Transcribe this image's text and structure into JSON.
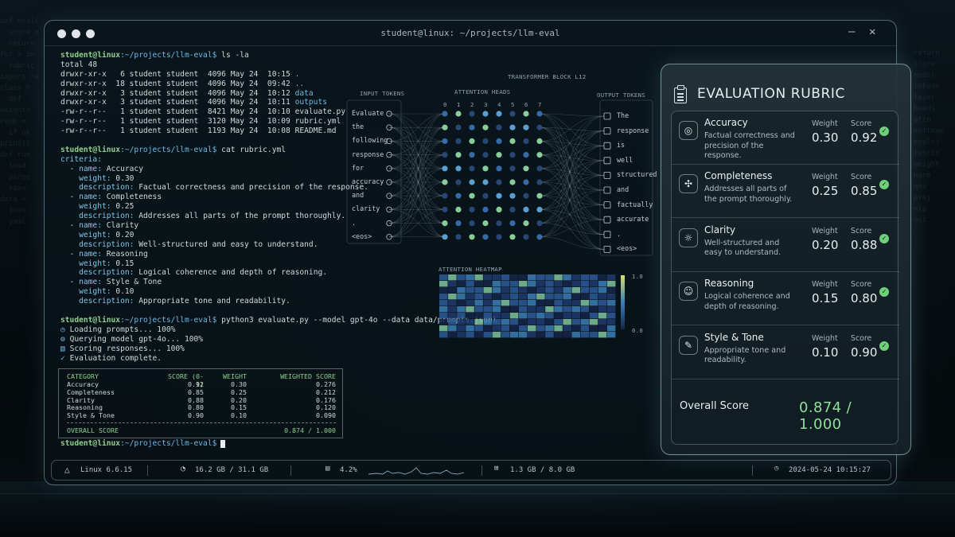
{
  "window": {
    "title": "student@linux: ~/projects/llm-eval",
    "close_label": "✕",
    "minimize_label": "—"
  },
  "terminal": {
    "prompt_user": "student@linux",
    "prompt_path": ":~/projects/llm-eval$",
    "cmd1": " ls -la",
    "ls_total": "total 48",
    "ls_rows": [
      {
        "prefix": "drwxr-xr-x   6 student student  4096 May 24  10:15 ",
        "name": "."
      },
      {
        "prefix": "drwxr-xr-x  18 student student  4096 May 24  09:42 ",
        "name": ".."
      },
      {
        "prefix": "drwxr-xr-x   3 student student  4096 May 24  10:12 ",
        "name": "data"
      },
      {
        "prefix": "drwxr-xr-x   3 student student  4096 May 24  10:11 ",
        "name": "outputs"
      },
      {
        "prefix": "-rw-r--r--   1 student student  8421 May 24  10:10 ",
        "name": "evaluate.py"
      },
      {
        "prefix": "-rw-r--r--   1 student student  3120 May 24  10:09 ",
        "name": "rubric.yml"
      },
      {
        "prefix": "-rw-r--r--   1 student student  1193 May 24  10:08 ",
        "name": "README.md"
      }
    ],
    "cmd2": " cat rubric.yml",
    "yaml_root": "criteria:",
    "yaml_key_name": "name:",
    "yaml_key_weight": "weight:",
    "yaml_key_desc": "description:",
    "yaml": [
      {
        "name": "Accuracy",
        "weight": "0.30",
        "description": "Factual correctness and precision of the response."
      },
      {
        "name": "Completeness",
        "weight": "0.25",
        "description": "Addresses all parts of the prompt thoroughly."
      },
      {
        "name": "Clarity",
        "weight": "0.20",
        "description": "Well-structured and easy to understand."
      },
      {
        "name": "Reasoning",
        "weight": "0.15",
        "description": "Logical coherence and depth of reasoning."
      },
      {
        "name": "Style & Tone",
        "weight": "0.10",
        "description": "Appropriate tone and readability."
      }
    ],
    "cmd3": " python3 evaluate.py --model gpt-4o --data data/prompts.jsonl",
    "progress": [
      {
        "icon": "◷",
        "text": "Loading prompts... 100%"
      },
      {
        "icon": "⚙",
        "text": "Querying model gpt-4o... 100%"
      },
      {
        "icon": "▤",
        "text": "Scoring responses... 100%"
      },
      {
        "icon": "✓",
        "text": "Evaluation complete."
      }
    ],
    "results": {
      "headers": [
        "CATEGORY",
        "SCORE (0-1)",
        "WEIGHT",
        "WEIGHTED SCORE"
      ],
      "rows": [
        [
          "Accuracy",
          "0.92",
          "0.30",
          "0.276"
        ],
        [
          "Completeness",
          "0.85",
          "0.25",
          "0.212"
        ],
        [
          "Clarity",
          "0.88",
          "0.20",
          "0.176"
        ],
        [
          "Reasoning",
          "0.80",
          "0.15",
          "0.120"
        ],
        [
          "Style & Tone",
          "0.90",
          "0.10",
          "0.090"
        ]
      ],
      "overall_label": "OVERALL SCORE",
      "overall_value": "0.874 / 1.000"
    }
  },
  "viz": {
    "block_title": "TRANSFORMER BLOCK L12",
    "input_label": "INPUT TOKENS",
    "heads_label": "ATTENTION HEADS",
    "output_label": "OUTPUT TOKENS",
    "heads": [
      "0",
      "1",
      "2",
      "3",
      "4",
      "5",
      "6",
      "7"
    ],
    "input_tokens": [
      "Evaluate",
      "the",
      "following",
      "response",
      "for",
      "accuracy",
      "and",
      "clarity",
      ".",
      "<eos>"
    ],
    "output_tokens": [
      "The",
      "response",
      "is",
      "well",
      "structured",
      "and",
      "factually",
      "accurate",
      ".",
      "<eos>"
    ],
    "heatmap_label": "ATTENTION HEATMAP",
    "heatmap_scale_max": "1.0",
    "heatmap_scale_min": "0.0"
  },
  "statusbar": {
    "os": "Linux 6.6.15",
    "memory": "16.2 GB / 31.1 GB",
    "cpu": "4.2%",
    "gpu": "1.3 GB / 8.0 GB",
    "datetime": "2024-05-24  10:15:27"
  },
  "rubric": {
    "title": "EVALUATION RUBRIC",
    "weight_label": "Weight",
    "score_label": "Score",
    "criteria": [
      {
        "icon": "target-icon",
        "name": "Accuracy",
        "description": "Factual correctness and precision of the response.",
        "weight": "0.30",
        "score": "0.92"
      },
      {
        "icon": "puzzle-icon",
        "name": "Completeness",
        "description": "Addresses all parts of the prompt thoroughly.",
        "weight": "0.25",
        "score": "0.85"
      },
      {
        "icon": "bulb-icon",
        "name": "Clarity",
        "description": "Well-structured and easy to understand.",
        "weight": "0.20",
        "score": "0.88"
      },
      {
        "icon": "head-icon",
        "name": "Reasoning",
        "description": "Logical coherence and depth of reasoning.",
        "weight": "0.15",
        "score": "0.80"
      },
      {
        "icon": "pen-icon",
        "name": "Style & Tone",
        "description": "Appropriate tone and readability.",
        "weight": "0.10",
        "score": "0.90"
      }
    ],
    "overall_label": "Overall Score",
    "overall_value": "0.874 / 1.000"
  },
  "colors": {
    "prompt": "#8fd08f",
    "path": "#6fb7e5",
    "accent_green": "#8fe09a",
    "panel_border": "#bfe1eb"
  }
}
